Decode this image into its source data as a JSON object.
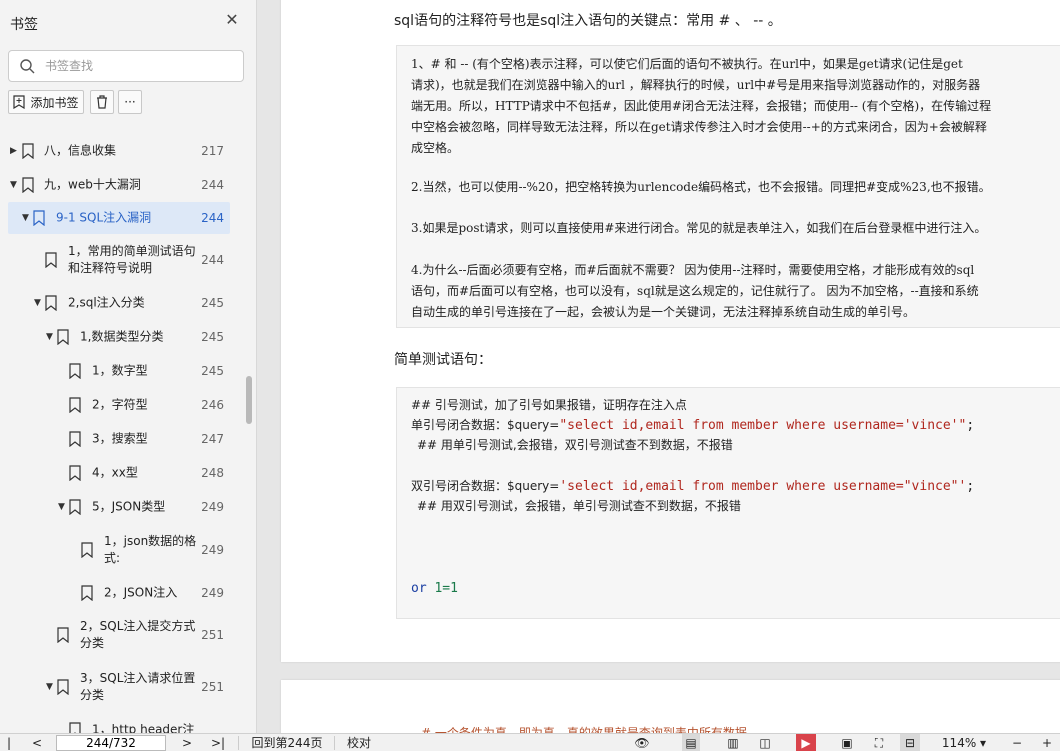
{
  "sidebar": {
    "title": "书签",
    "search_placeholder": "书签查找",
    "add_bookmark_label": "添加书签",
    "more_label": "···",
    "items": [
      {
        "label": "八，信息收集",
        "page": "217"
      },
      {
        "label": "九，web十大漏洞",
        "page": "244"
      },
      {
        "label": "9-1 SQL注入漏洞",
        "page": "244"
      },
      {
        "label_line1": "1，常用的简单测试语句",
        "label_line2": "和注释符号说明",
        "page": "244"
      },
      {
        "label": "2,sql注入分类",
        "page": "245"
      },
      {
        "label": "1,数据类型分类",
        "page": "245"
      },
      {
        "label": "1，数字型",
        "page": "245"
      },
      {
        "label": "2，字符型",
        "page": "246"
      },
      {
        "label": "3，搜索型",
        "page": "247"
      },
      {
        "label": "4，xx型",
        "page": "248"
      },
      {
        "label": "5，JSON类型",
        "page": "249"
      },
      {
        "label_line1": "1，json数据的格",
        "label_line2": "式:",
        "page": "249"
      },
      {
        "label": "2，JSON注入",
        "page": "249"
      },
      {
        "label_line1": "2，SQL注入提交方式",
        "label_line2": "分类",
        "page": "251"
      },
      {
        "label_line1": "3，SQL注入请求位置",
        "label_line2": "分类",
        "page": "251"
      },
      {
        "label": "1，http header注",
        "page": ""
      }
    ]
  },
  "document": {
    "heading1": "sql语句的注释符号也是sql注入语句的关键点：常用 # 、 -- 。",
    "quote": [
      "1、# 和 -- (有个空格)表示注释，可以使它们后面的语句不被执行。在url中，如果是get请求(记住是get",
      "请求)，也就是我们在浏览器中输入的url ，解释执行的时候，url中#号是用来指导浏览器动作的，对服务器",
      "端无用。所以，HTTP请求中不包括#，因此使用#闭合无法注释，会报错；而使用-- (有个空格)，在传输过程",
      "中空格会被忽略，同样导致无法注释，所以在get请求传参注入时才会使用--+的方式来闭合，因为+会被解释",
      "成空格。",
      "2.当然，也可以使用--%20，把空格转换为urlencode编码格式，也不会报错。同理把#变成%23,也不报错。",
      "3.如果是post请求，则可以直接使用#来进行闭合。常见的就是表单注入，如我们在后台登录框中进行注入。",
      "4.为什么--后面必须要有空格，而#后面就不需要？ 因为使用--注释时，需要使用空格，才能形成有效的sql",
      "语句，而#后面可以有空格，也可以没有，sql就是这么规定的，记住就行了。 因为不加空格，--直接和系统",
      "自动生成的单引号连接在了一起，会被认为是一个关键词，无法注释掉系统自动生成的单引号。"
    ],
    "heading2": "简单测试语句：",
    "code": {
      "c1": "## 引号测试，加了引号如果报错，证明存在注入点",
      "l2_prefix": "单引号闭合数据：$query=",
      "l2_str": "\"select id,email from member where username='vince'\"",
      "l2_end": ";",
      "c3": "## 用单引号测试,会报错，双引号测试查不到数据，不报错",
      "l5_prefix": "双引号闭合数据：$query=",
      "l5_str": "'select id,email from member where username=\"vince\"'",
      "l5_end": ";",
      "c6": "## 用双引号测试，会报错，单引号测试查不到数据，不报错",
      "or_kw": "or",
      "or_expr": "1=1"
    },
    "page2_text": "# 一个条件为真，即为真，真的效果就是查询到表中所有数据"
  },
  "statusbar": {
    "page_value": "244/732",
    "goto_label": "回到第244页",
    "proof_label": "校对",
    "zoom": "114%"
  }
}
